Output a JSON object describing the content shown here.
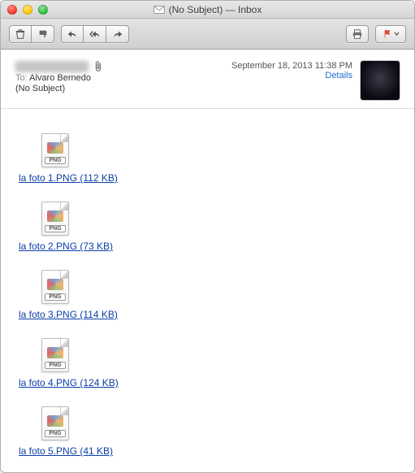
{
  "window": {
    "title": "(No Subject) — Inbox"
  },
  "header": {
    "to_label": "To:",
    "to_name": "Alvaro Bernedo",
    "subject": "(No Subject)",
    "date": "September 18, 2013 11:38 PM",
    "details": "Details"
  },
  "attachments": [
    {
      "label": "la foto 1.PNG (112 KB)",
      "badge": "PNG"
    },
    {
      "label": "la foto 2.PNG (73 KB)",
      "badge": "PNG"
    },
    {
      "label": "la foto 3.PNG (114 KB)",
      "badge": "PNG"
    },
    {
      "label": "la foto 4.PNG (124 KB)",
      "badge": "PNG"
    },
    {
      "label": "la foto 5.PNG (41 KB)",
      "badge": "PNG"
    }
  ]
}
